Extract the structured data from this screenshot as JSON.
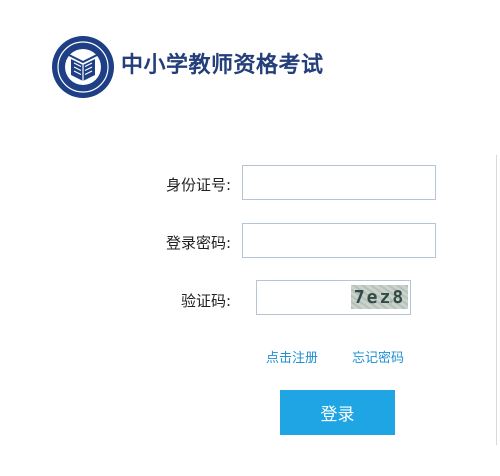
{
  "header": {
    "title": "中小学教师资格考试",
    "logo_icon": "book-emblem-icon"
  },
  "form": {
    "id_label": "身份证号:",
    "id_value": "",
    "password_label": "登录密码:",
    "password_value": "",
    "captcha_label": "验证码:",
    "captcha_value": "",
    "captcha_code": "7ez8"
  },
  "links": {
    "register": "点击注册",
    "forgot_password": "忘记密码"
  },
  "login_button": "登录",
  "colors": {
    "brand": "#233e7a",
    "accent": "#1fa5e4",
    "link": "#1f8fd1"
  }
}
